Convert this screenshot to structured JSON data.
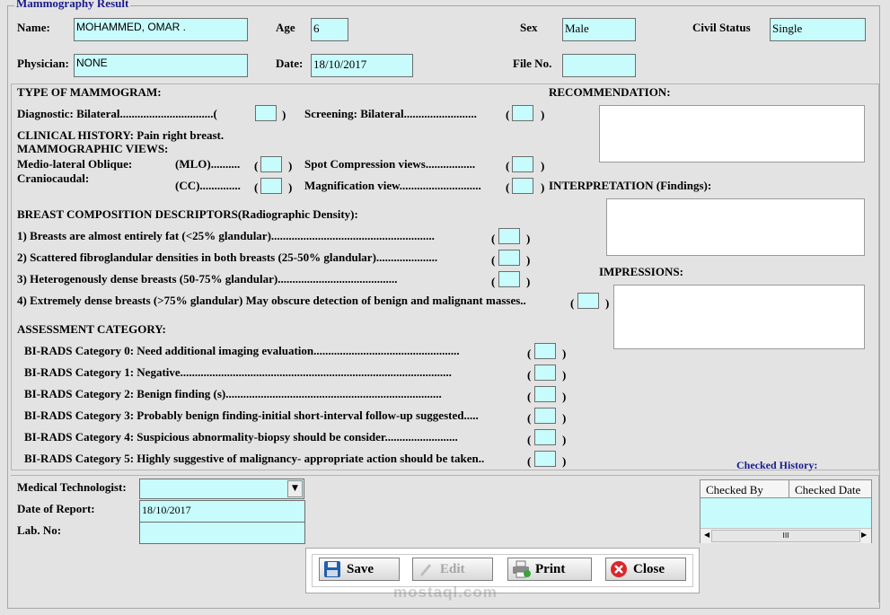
{
  "form": {
    "title": "Mammography Result",
    "name_label": "Name:",
    "name_value": "MOHAMMED, OMAR .",
    "age_label": "Age",
    "age_value": "6",
    "sex_label": "Sex",
    "sex_value": "Male",
    "civil_label": "Civil Status",
    "civil_value": "Single",
    "physician_label": "Physician:",
    "physician_value": "NONE",
    "date_label": "Date:",
    "date_value": "18/10/2017",
    "file_label": "File No.",
    "file_value": ""
  },
  "mammogram": {
    "type_heading": "TYPE OF MAMMOGRAM:",
    "diagnostic": "Diagnostic: Bilateral................................(",
    "screening": "Screening: Bilateral.........................",
    "clinical": "CLINICAL HISTORY: Pain right breast.",
    "views_heading": "MAMMOGRAPHIC VIEWS:",
    "mlo_label": "Medio-lateral Oblique:",
    "mlo_code": "(MLO)..........",
    "cc_label": "Craniocaudal:",
    "cc_code": "(CC)..............",
    "spot": "Spot Compression views.................",
    "magnification": "Magnification view............................"
  },
  "composition": {
    "heading": "BREAST COMPOSITION DESCRIPTORS(Radiographic Density):",
    "items": [
      "1) Breasts are almost entirely fat (<25% glandular)........................................................",
      "2) Scattered fibroglandular densities in both breasts (25-50% glandular).....................",
      "3) Heterogenously dense breasts (50-75% glandular).........................................",
      "4) Extremely dense breasts (>75% glandular) May obscure detection of benign and malignant masses.."
    ]
  },
  "assessment": {
    "heading": "ASSESSMENT CATEGORY:",
    "items": [
      "BI-RADS Category 0: Need additional imaging evaluation..................................................",
      "BI-RADS Category 1: Negative.............................................................................................",
      "BI-RADS Category 2: Benign finding (s)..........................................................................",
      "BI-RADS Category 3: Probably benign finding-initial short-interval follow-up suggested.....",
      "BI-RADS Category 4:  Suspicious abnormality-biopsy should be consider.........................",
      "BI-RADS Category 5: Highly suggestive of malignancy- appropriate action should be taken.."
    ]
  },
  "right_panel": {
    "recommendation": "RECOMMENDATION:",
    "interpretation": "INTERPRETATION (Findings):",
    "impressions": "IMPRESSIONS:"
  },
  "footer": {
    "med_tech_label": "Medical Technologist:",
    "date_report_label": "Date of Report:",
    "date_report_value": "18/10/2017",
    "lab_label": "Lab. No:",
    "checked_history": "Checked History:",
    "col_checked_by": "Checked By",
    "col_checked_date": "Checked Date",
    "scroll_thumb": "III"
  },
  "buttons": {
    "save": "Save",
    "edit": "Edit",
    "print": "Print",
    "close": "Close"
  },
  "watermark": {
    "text": "mostaql.com"
  },
  "colors": {
    "field_bg": "#c8fbfb",
    "title_color": "#1a1a8c",
    "close_icon": "#d9262c",
    "save_icon": "#1f5fae"
  }
}
